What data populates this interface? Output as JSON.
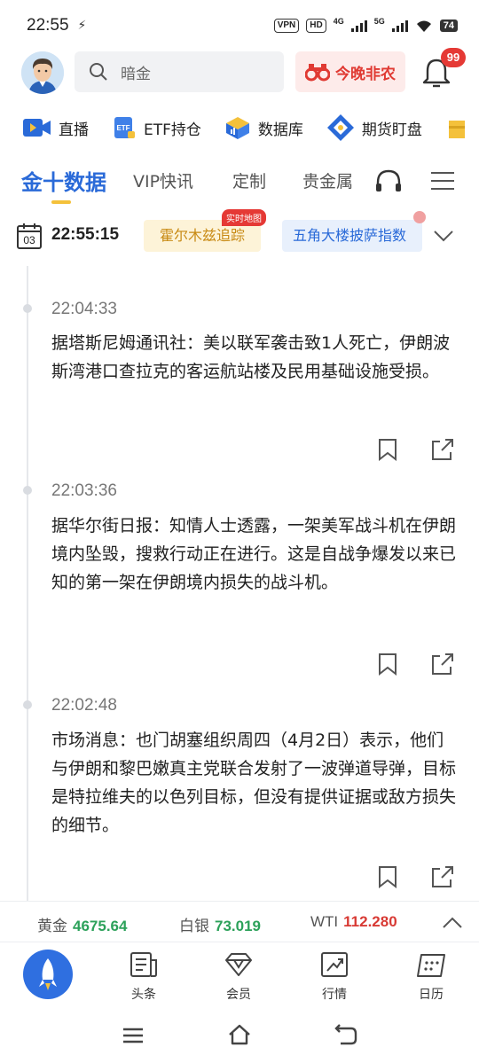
{
  "status": {
    "time": "22:55",
    "vpn": "VPN",
    "hd": "HD",
    "net1": "4G",
    "net2": "5G",
    "battery": "74"
  },
  "header": {
    "search_placeholder": "暗金",
    "promo_label": "今晚非农",
    "notification_count": "99"
  },
  "quick_links": [
    {
      "label": "直播",
      "icon": "live-video-icon"
    },
    {
      "label": "ETF持仓",
      "icon": "etf-icon"
    },
    {
      "label": "数据库",
      "icon": "database-icon"
    },
    {
      "label": "期货盯盘",
      "icon": "futures-icon"
    }
  ],
  "tabs": [
    {
      "label": "金十数据",
      "active": true
    },
    {
      "label": "VIP快讯"
    },
    {
      "label": "定制"
    },
    {
      "label": "贵金属"
    }
  ],
  "current_time": "22:55:15",
  "calendar_day": "03",
  "topics": [
    {
      "label": "霍尔木兹追踪",
      "badge": "实时地图"
    },
    {
      "label": "五角大楼披萨指数"
    }
  ],
  "news": [
    {
      "time": "22:04:33",
      "text": "据塔斯尼姆通讯社：美以联军袭击致1人死亡，伊朗波斯湾港口查拉克的客运航站楼及民用基础设施受损。"
    },
    {
      "time": "22:03:36",
      "text": "据华尔街日报：知情人士透露，一架美军战斗机在伊朗境内坠毁，搜救行动正在进行。这是自战争爆发以来已知的第一架在伊朗境内损失的战斗机。"
    },
    {
      "time": "22:02:48",
      "text": "市场消息：也门胡塞组织周四（4月2日）表示，他们与伊朗和黎巴嫩真主党联合发射了一波弹道导弹，目标是特拉维夫的以色列目标，但没有提供证据或敌方损失的细节。"
    }
  ],
  "prices": [
    {
      "name": "黄金",
      "value": "4675.64",
      "trend": "up"
    },
    {
      "name": "白银",
      "value": "73.019",
      "trend": "up"
    },
    {
      "name": "WTI",
      "value": "112.280",
      "trend": "down"
    }
  ],
  "bottom_nav": [
    {
      "label": "头条"
    },
    {
      "label": "会员"
    },
    {
      "label": "行情"
    },
    {
      "label": "日历"
    }
  ],
  "colors": {
    "accent": "#2a6ad8",
    "price_up": "#2ca15a",
    "price_down": "#d83a34",
    "badge_red": "#e53935"
  }
}
